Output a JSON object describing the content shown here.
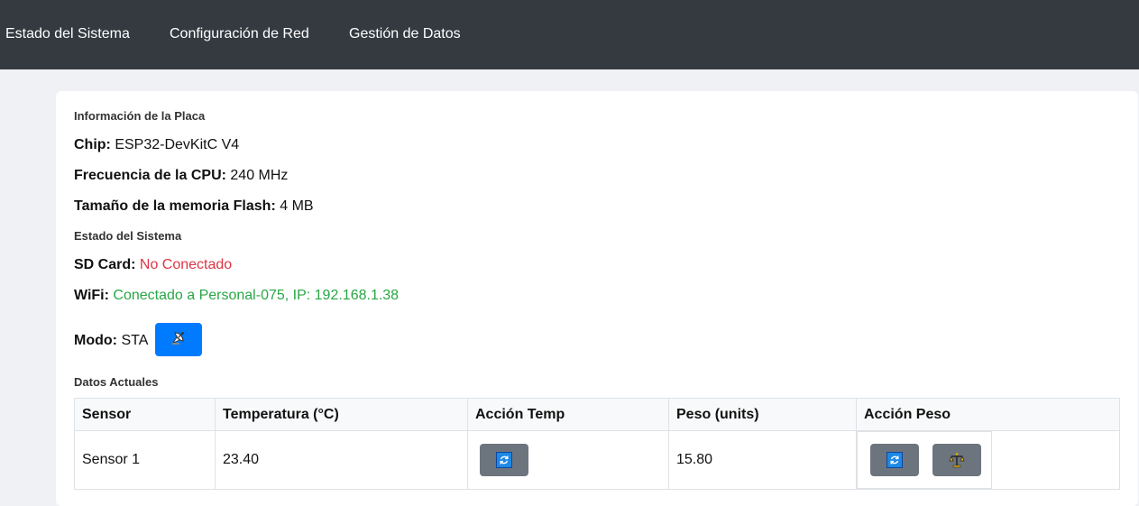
{
  "nav": {
    "items": [
      "Estado del Sistema",
      "Configuración de Red",
      "Gestión de Datos"
    ]
  },
  "board_info": {
    "title": "Información de la Placa",
    "chip_label": "Chip:",
    "chip_value": "ESP32-DevKitC V4",
    "cpu_label": "Frecuencia de la CPU:",
    "cpu_value": "240 MHz",
    "flash_label": "Tamaño de la memoria Flash:",
    "flash_value": "4 MB"
  },
  "system_status": {
    "title": "Estado del Sistema",
    "sd_label": "SD Card:",
    "sd_value": "No Conectado",
    "wifi_label": "WiFi:",
    "wifi_value": "Conectado a Personal-075, IP: 192.168.1.38",
    "mode_label": "Modo:",
    "mode_value": "STA",
    "mode_button_icon": "satellite-antenna-icon"
  },
  "current_data": {
    "title": "Datos Actuales",
    "columns": [
      "Sensor",
      "Temperatura (°C)",
      "Acción Temp",
      "Peso (units)",
      "Acción Peso"
    ],
    "rows": [
      {
        "sensor": "Sensor 1",
        "temperature": "23.40",
        "weight": "15.80",
        "temp_action_icon": "refresh-icon",
        "weight_action_icons": [
          "refresh-icon",
          "scale-icon"
        ]
      }
    ]
  },
  "colors": {
    "navbar": "#343a40",
    "primary": "#007bff",
    "danger": "#dc3545",
    "success": "#28a745",
    "secondary": "#6c757d"
  }
}
